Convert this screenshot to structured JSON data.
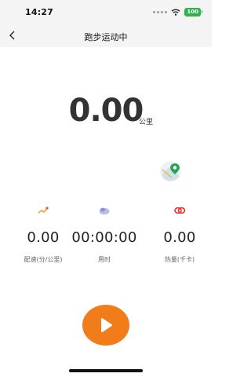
{
  "status": {
    "time": "14:27",
    "battery": "100"
  },
  "nav": {
    "title": "跑步运动中"
  },
  "distance": {
    "value": "0.00",
    "unit": "公里"
  },
  "metrics": [
    {
      "value": "0.00",
      "label": "配速(分/公里)",
      "icon": "pace-icon"
    },
    {
      "value": "00:00:00",
      "label": "用时",
      "icon": "time-icon"
    },
    {
      "value": "0.00",
      "label": "热量(千卡)",
      "icon": "calorie-icon"
    }
  ],
  "colors": {
    "accent": "#f07c1a",
    "battery": "#2fb14f",
    "map_pin": "#29a35a"
  }
}
